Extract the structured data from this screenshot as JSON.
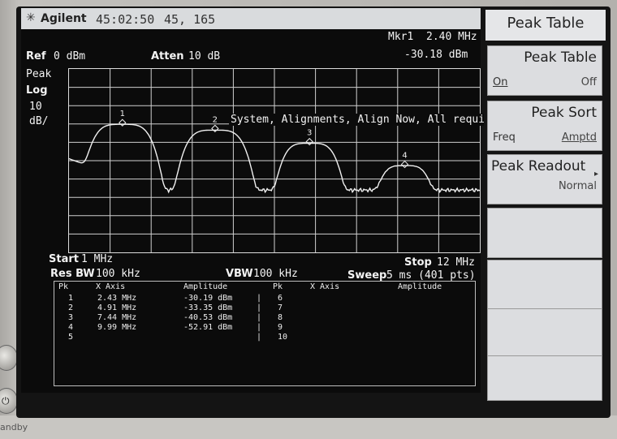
{
  "header": {
    "brand": "Agilent",
    "time": "45:02:50",
    "coords": "45, 165"
  },
  "marker": {
    "label": "Mkr1",
    "freq": "2.40 MHz",
    "amplitude": "-30.18 dBm"
  },
  "display_settings": {
    "ref_label": "Ref",
    "ref_value": "0 dBm",
    "atten_label": "Atten",
    "atten_value": "10 dB",
    "detector": "Peak",
    "scale": "Log",
    "scale_value": "10",
    "scale_unit": "dB/"
  },
  "message": "System, Alignments, Align Now, All required",
  "trace_markers": [
    "1",
    "2",
    "3",
    "4"
  ],
  "footer": {
    "start_label": "Start",
    "start_value": "1 MHz",
    "stop_label": "Stop",
    "stop_value": "12 MHz",
    "resbw_label": "Res BW",
    "resbw_value": "100 kHz",
    "vbw_label": "VBW",
    "vbw_value": "100 kHz",
    "sweep_label": "Sweep",
    "sweep_value": "5 ms (401 pts)"
  },
  "peak_table": {
    "headers": [
      "Pk",
      "X Axis",
      "Amplitude",
      "Pk",
      "X Axis",
      "Amplitude"
    ],
    "left_rows": [
      {
        "pk": "1",
        "x": "2.43 MHz",
        "amp": "-30.19 dBm"
      },
      {
        "pk": "2",
        "x": "4.91 MHz",
        "amp": "-33.35 dBm"
      },
      {
        "pk": "3",
        "x": "7.44 MHz",
        "amp": "-40.53 dBm"
      },
      {
        "pk": "4",
        "x": "9.99 MHz",
        "amp": "-52.91 dBm"
      },
      {
        "pk": "5",
        "x": "",
        "amp": ""
      }
    ],
    "right_rows": [
      {
        "pk": "6"
      },
      {
        "pk": "7"
      },
      {
        "pk": "8"
      },
      {
        "pk": "9"
      },
      {
        "pk": "10"
      }
    ]
  },
  "softkeys": {
    "title": "Peak Table",
    "peak_table": {
      "label": "Peak Table",
      "on": "On",
      "off": "Off"
    },
    "peak_sort": {
      "label": "Peak Sort",
      "freq": "Freq",
      "amptd": "Amptd"
    },
    "peak_readout": {
      "label": "Peak Readout",
      "value": "Normal"
    }
  },
  "hardware": {
    "standby_label": "andby"
  },
  "trace_color": "#f0f0f0"
}
